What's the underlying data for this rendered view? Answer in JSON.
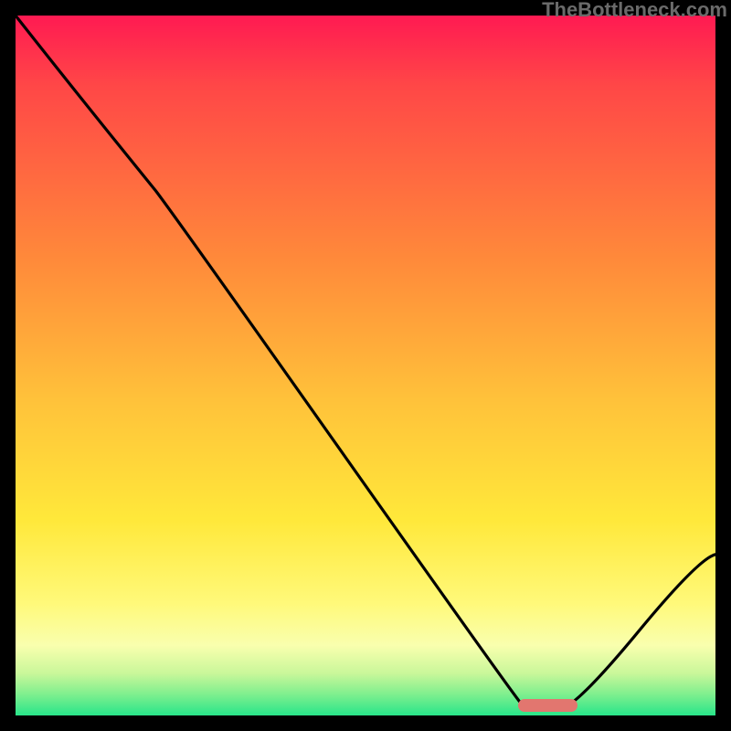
{
  "watermark_text": "TheBottleneck.com",
  "chart_data": {
    "type": "line",
    "title": "",
    "xlabel": "",
    "ylabel": "",
    "xlim": [
      0,
      100
    ],
    "ylim": [
      0,
      100
    ],
    "grid": false,
    "series": [
      {
        "name": "bottleneck-curve",
        "x": [
          0,
          20,
          72,
          78,
          100
        ],
        "y": [
          100,
          75,
          2,
          1,
          23
        ],
        "color": "#000000"
      }
    ],
    "marker": {
      "name": "optimal-range",
      "x_start": 72,
      "x_end": 80,
      "y": 1.5,
      "color": "#e2766f"
    },
    "background_gradient": {
      "stops": [
        {
          "pos": 0,
          "color": "#ff1a52"
        },
        {
          "pos": 10,
          "color": "#ff4747"
        },
        {
          "pos": 35,
          "color": "#ff8a3a"
        },
        {
          "pos": 55,
          "color": "#ffc23a"
        },
        {
          "pos": 72,
          "color": "#ffe83a"
        },
        {
          "pos": 84,
          "color": "#fff97a"
        },
        {
          "pos": 90,
          "color": "#f9ffae"
        },
        {
          "pos": 94,
          "color": "#c9f79a"
        },
        {
          "pos": 97,
          "color": "#7eef8e"
        },
        {
          "pos": 100,
          "color": "#28e58a"
        }
      ]
    }
  }
}
